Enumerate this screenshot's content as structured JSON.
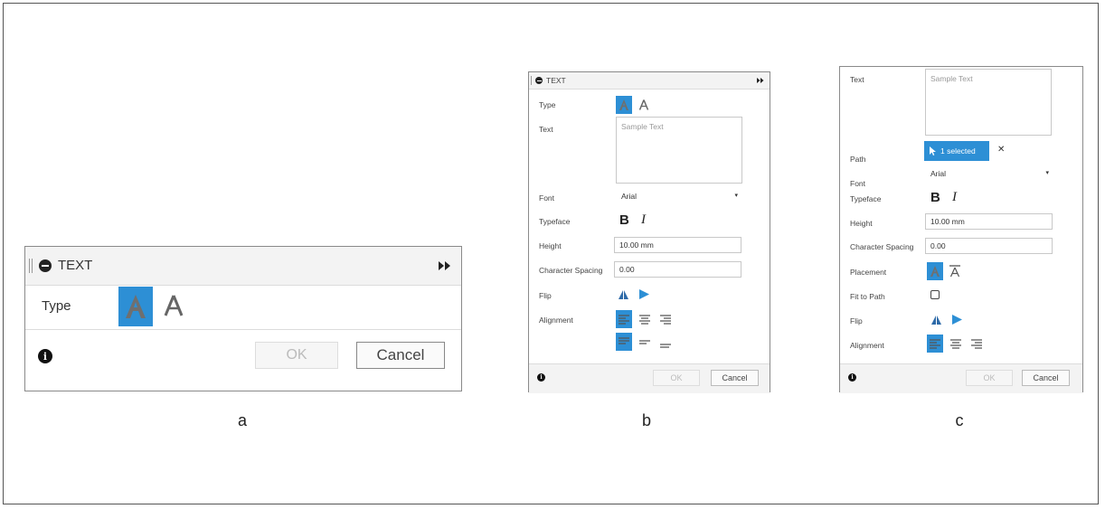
{
  "panel_a": {
    "title": "TEXT",
    "type_label": "Type",
    "ok": "OK",
    "cancel": "Cancel",
    "caption": "a"
  },
  "panel_b": {
    "title": "TEXT",
    "type_label": "Type",
    "text_label": "Text",
    "text_value": "Sample Text",
    "font_label": "Font",
    "font_value": "Arial",
    "typeface_label": "Typeface",
    "height_label": "Height",
    "height_value": "10.00 mm",
    "char_spacing_label": "Character Spacing",
    "char_spacing_value": "0.00",
    "flip_label": "Flip",
    "alignment_label": "Alignment",
    "ok": "OK",
    "cancel": "Cancel",
    "caption": "b"
  },
  "panel_c": {
    "text_label": "Text",
    "text_value": "Sample Text",
    "path_label": "Path",
    "path_value": "1 selected",
    "font_label": "Font",
    "font_value": "Arial",
    "typeface_label": "Typeface",
    "height_label": "Height",
    "height_value": "10.00 mm",
    "char_spacing_label": "Character Spacing",
    "char_spacing_value": "0.00",
    "placement_label": "Placement",
    "fit_to_path_label": "Fit to Path",
    "flip_label": "Flip",
    "alignment_label": "Alignment",
    "ok": "OK",
    "cancel": "Cancel",
    "caption": "c"
  },
  "icons": {
    "bold": "B",
    "italic": "I",
    "info": "i",
    "close": "✕",
    "collapse": "−",
    "expand": "▸▸"
  },
  "colors": {
    "accent": "#2d8fd5",
    "border": "#8a8a8a",
    "header": "#f3f3f3"
  }
}
